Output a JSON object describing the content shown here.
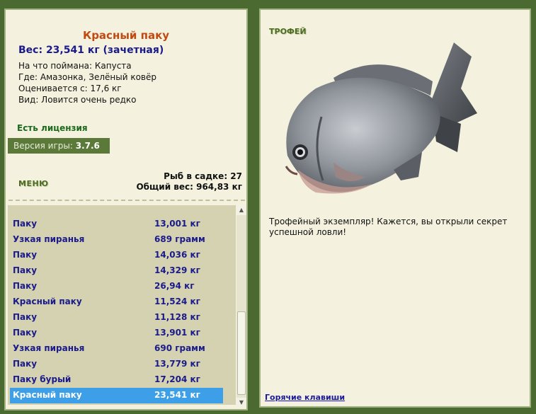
{
  "fish": {
    "name": "Красный паку",
    "weight": "Вес: 23,541 кг (зачетная)",
    "bait": "На что поймана: Капуста",
    "location": "Где: Амазонка, Зелёный ковёр",
    "rated_from": "Оценивается с: 17,6 кг",
    "kind": "Вид: Ловится очень редко"
  },
  "license": "Есть лицензия",
  "version": {
    "label": "Версия игры: ",
    "value": "3.7.6"
  },
  "menu_label": "МЕНЮ",
  "stats": {
    "count": "Рыб в садке: 27",
    "total": "Общий вес: 964,83 кг"
  },
  "catch_list": [
    {
      "name": "Паку",
      "weight": "13,001 кг"
    },
    {
      "name": "Узкая пиранья",
      "weight": "689 грамм"
    },
    {
      "name": "Паку",
      "weight": "14,036 кг"
    },
    {
      "name": "Паку",
      "weight": "14,329 кг"
    },
    {
      "name": "Паку",
      "weight": "26,94 кг"
    },
    {
      "name": "Красный паку",
      "weight": "11,524 кг"
    },
    {
      "name": "Паку",
      "weight": "11,128 кг"
    },
    {
      "name": "Паку",
      "weight": "13,901 кг"
    },
    {
      "name": "Узкая пиранья",
      "weight": "690 грамм"
    },
    {
      "name": "Паку",
      "weight": "13,779 кг"
    },
    {
      "name": "Паку бурый",
      "weight": "17,204 кг"
    },
    {
      "name": "Красный паку",
      "weight": "23,541 кг"
    }
  ],
  "selected_index": 11,
  "trophy_label": "ТРОФЕЙ",
  "trophy_message": "Трофейный экземпляр! Кажется, вы открыли секрет успешной ловли!",
  "hotkeys_link": "Горячие клавиши",
  "icons": {
    "scroll_up": "triangle-up-icon",
    "scroll_down": "triangle-down-icon"
  },
  "colors": {
    "selected_row": "#3d9fe8",
    "title": "#c04a12",
    "list_text": "#1a1a8c",
    "panel_bg": "#f4f2de",
    "frame": "#4b6a32"
  }
}
